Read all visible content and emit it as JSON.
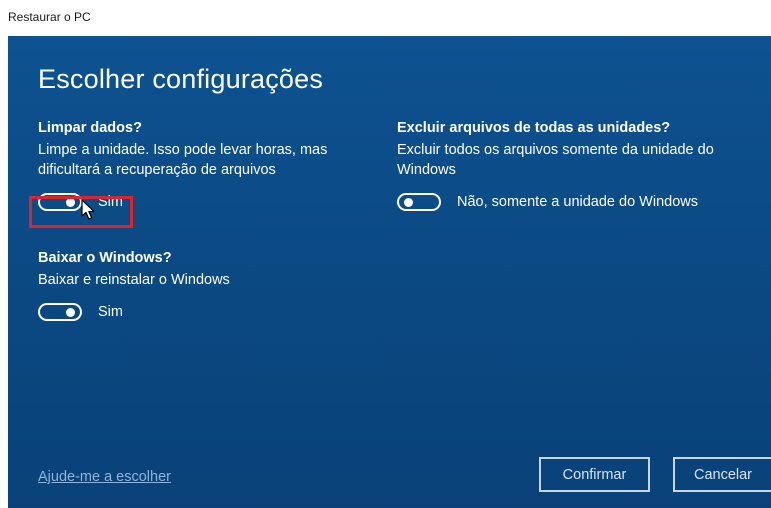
{
  "window": {
    "title": "Restaurar o PC"
  },
  "page": {
    "heading": "Escolher configurações"
  },
  "clean_data": {
    "title": "Limpar dados?",
    "description": "Limpe a unidade. Isso pode levar horas, mas dificultará a recuperação de arquivos",
    "toggle_state": "on",
    "toggle_label": "Sim"
  },
  "delete_files": {
    "title": "Excluir arquivos de todas as unidades?",
    "description": "Excluir todos os arquivos somente da unidade do Windows",
    "toggle_state": "off",
    "toggle_label": "Não, somente a unidade do Windows"
  },
  "download_windows": {
    "title": "Baixar o Windows?",
    "description": "Baixar e reinstalar o Windows",
    "toggle_state": "on",
    "toggle_label": "Sim"
  },
  "footer": {
    "help_link": "Ajude-me a escolher",
    "confirm_label": "Confirmar",
    "cancel_label": "Cancelar"
  },
  "colors": {
    "panel_background": "#0b4a84",
    "highlight_border": "#e0232b",
    "link": "#8fb4dc"
  },
  "icons": {
    "cursor": "mouse-pointer-icon"
  }
}
